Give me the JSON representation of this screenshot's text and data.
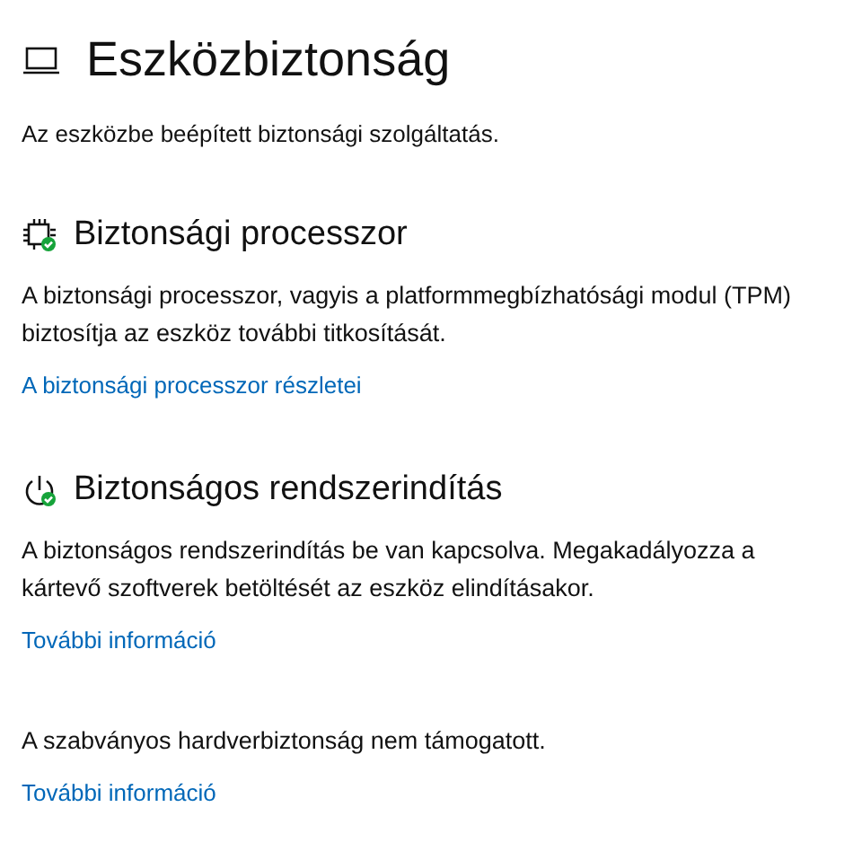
{
  "page": {
    "title": "Eszközbiztonság",
    "subtitle": "Az eszközbe beépített biztonsági szolgáltatás."
  },
  "sections": [
    {
      "kind": "processor",
      "heading": "Biztonsági processzor",
      "text": "A biztonsági processzor, vagyis a platformmegbízhatósági modul (TPM) biztosítja az eszköz további titkosítását.",
      "link": "A biztonsági processzor részletei"
    },
    {
      "kind": "boot",
      "heading": "Biztonságos rendszerindítás",
      "text": "A biztonságos rendszerindítás be van kapcsolva. Megakadályozza a kártevő szoftverek betöltését az eszköz elindításakor.",
      "link": "További információ"
    },
    {
      "kind": "note",
      "text": "A szabványos hardverbiztonság nem támogatott.",
      "link": "További információ"
    }
  ]
}
